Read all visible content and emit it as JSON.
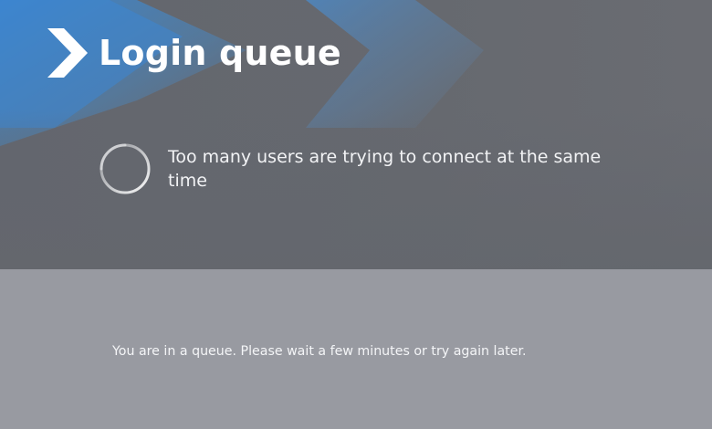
{
  "header": {
    "title": "Login queue",
    "icon": "chevron-right-icon"
  },
  "status": {
    "icon": "loading-spinner-icon",
    "message": "Too many users are trying to connect at the same time"
  },
  "queue": {
    "message": "You are in a queue. Please wait a few minutes or try again later."
  },
  "colors": {
    "top_background": "#65686e",
    "bottom_background": "#989aa1",
    "accent_blue": "#3c7fc4",
    "text": "#ffffff"
  }
}
